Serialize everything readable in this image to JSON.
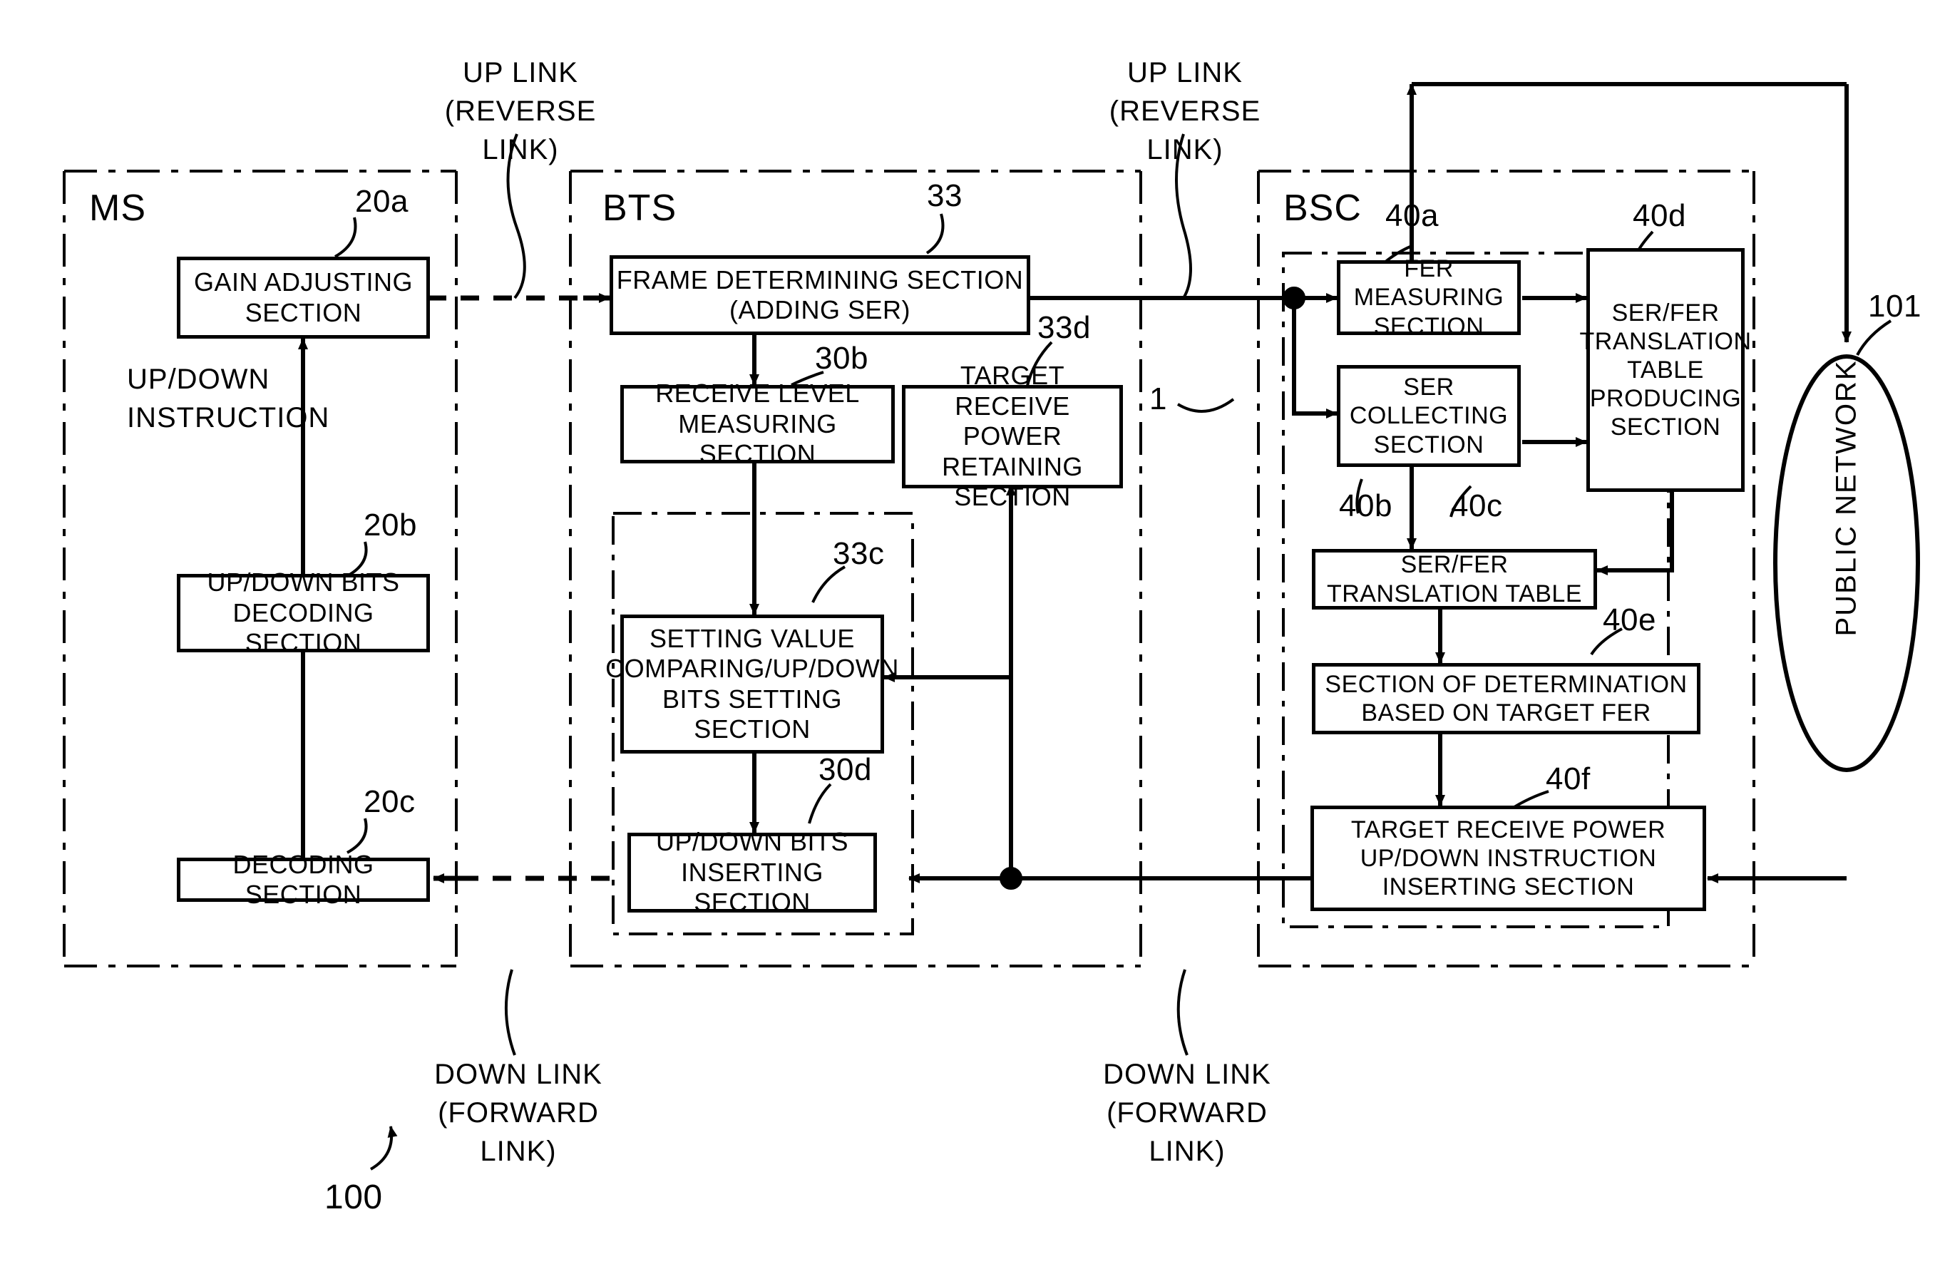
{
  "figure": {
    "system_ref": "100",
    "interface_ref": "1",
    "network_ref": "101"
  },
  "panels": [
    {
      "id": "ms",
      "label": "MS"
    },
    {
      "id": "bts",
      "label": "BTS"
    },
    {
      "id": "bsc",
      "label": "BSC"
    }
  ],
  "captions": {
    "uplink_left": "UP LINK\n(REVERSE LINK)",
    "uplink_right": "UP LINK\n(REVERSE LINK)",
    "downlink_left": "DOWN LINK\n(FORWARD LINK)",
    "downlink_right": "DOWN LINK\n(FORWARD LINK)",
    "updown_instruction": "UP/DOWN\nINSTRUCTION"
  },
  "ms": {
    "blocks": [
      {
        "ref": "20a",
        "label": "GAIN ADJUSTING\nSECTION"
      },
      {
        "ref": "20b",
        "label": "UP/DOWN BITS\nDECODING SECTION"
      },
      {
        "ref": "20c",
        "label": "DECODING SECTION"
      }
    ]
  },
  "bts": {
    "blocks": [
      {
        "ref": "33",
        "label": "FRAME DETERMINING SECTION\n(ADDING SER)"
      },
      {
        "ref": "30b",
        "label": "RECEIVE LEVEL\nMEASURING SECTION"
      },
      {
        "ref": "33d",
        "label": "TARGET RECEIVE\nPOWER RETAINING\nSECTION"
      },
      {
        "ref": "33c",
        "label": "SETTING VALUE\nCOMPARING/UP/DOWN\nBITS SETTING\nSECTION"
      },
      {
        "ref": "30d",
        "label": "UP/DOWN BITS\nINSERTING SECTION"
      }
    ]
  },
  "bsc": {
    "blocks": [
      {
        "ref": "40a",
        "label": "FER MEASURING\nSECTION"
      },
      {
        "ref": "40b",
        "label": "SER\nCOLLECTING\nSECTION"
      },
      {
        "ref": "40d",
        "label": "SER/FER\nTRANSLATION\nTABLE\nPRODUCING\nSECTION"
      },
      {
        "ref": "40c",
        "label": "SER/FER\nTRANSLATION TABLE"
      },
      {
        "ref": "40e",
        "label": "SECTION OF DETERMINATION\nBASED ON TARGET FER"
      },
      {
        "ref": "40f",
        "label": "TARGET RECEIVE POWER\nUP/DOWN INSTRUCTION\nINSERTING SECTION"
      }
    ]
  },
  "network": {
    "label": "PUBLIC NETWORK",
    "ref": "101"
  },
  "colors": {
    "ink": "#000000",
    "paper": "#ffffff"
  }
}
